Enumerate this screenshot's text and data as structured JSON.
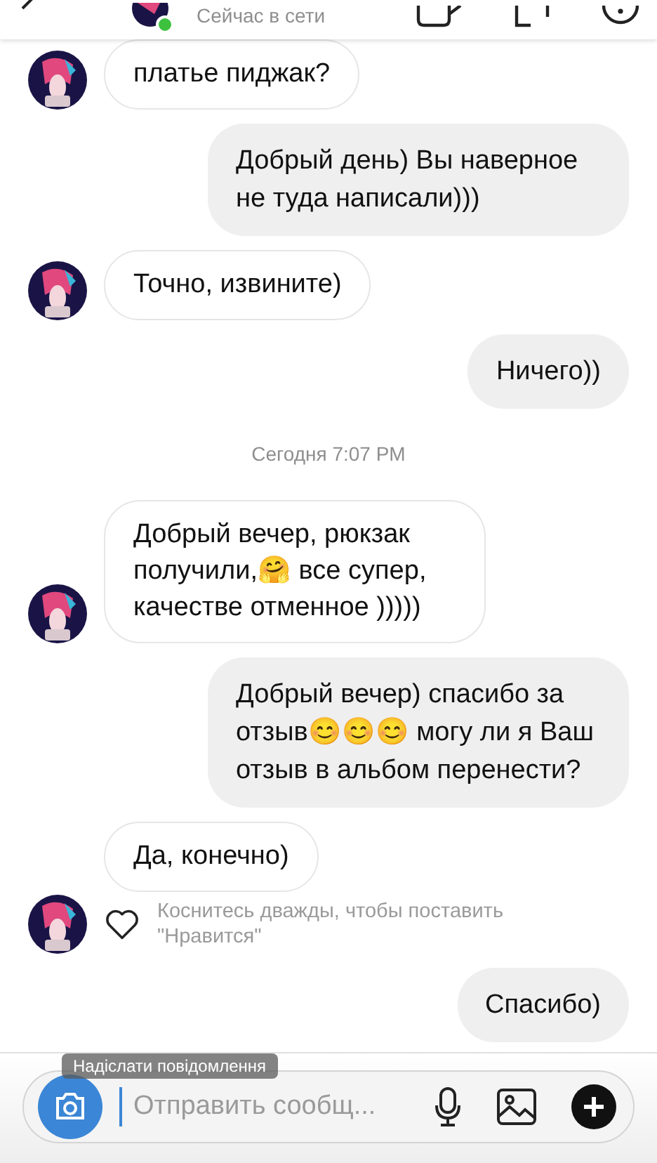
{
  "header": {
    "status": "Сейчас в сети",
    "online": true
  },
  "messages": [
    {
      "kind": "incoming",
      "text": "платье пиджак?",
      "avatar": true
    },
    {
      "kind": "outgoing",
      "text": "Добрый день) Вы наверное не туда написали)))"
    },
    {
      "kind": "incoming",
      "text": "Точно, извините)",
      "avatar": true
    },
    {
      "kind": "outgoing",
      "text": "Ничего))"
    },
    {
      "kind": "timestamp",
      "text": "Сегодня 7:07 PM"
    },
    {
      "kind": "incoming",
      "text": "Добрый вечер, рюкзак получили,🤗 все супер, качестве отменное )))))",
      "avatar": true
    },
    {
      "kind": "outgoing",
      "text": "Добрый вечер) спасибо за отзыв😊😊😊 могу ли я Ваш отзыв в альбом перенести?"
    },
    {
      "kind": "incoming",
      "text": "Да, конечно)",
      "avatar": false
    },
    {
      "kind": "like_hint",
      "text": "Коснитесь дважды, чтобы поставить \"Нравится\"",
      "avatar": true
    },
    {
      "kind": "outgoing",
      "text": "Спасибо)"
    }
  ],
  "composer": {
    "placeholder": "Отправить сообщ...",
    "overlay_label": "Надіслати повідомлення"
  }
}
